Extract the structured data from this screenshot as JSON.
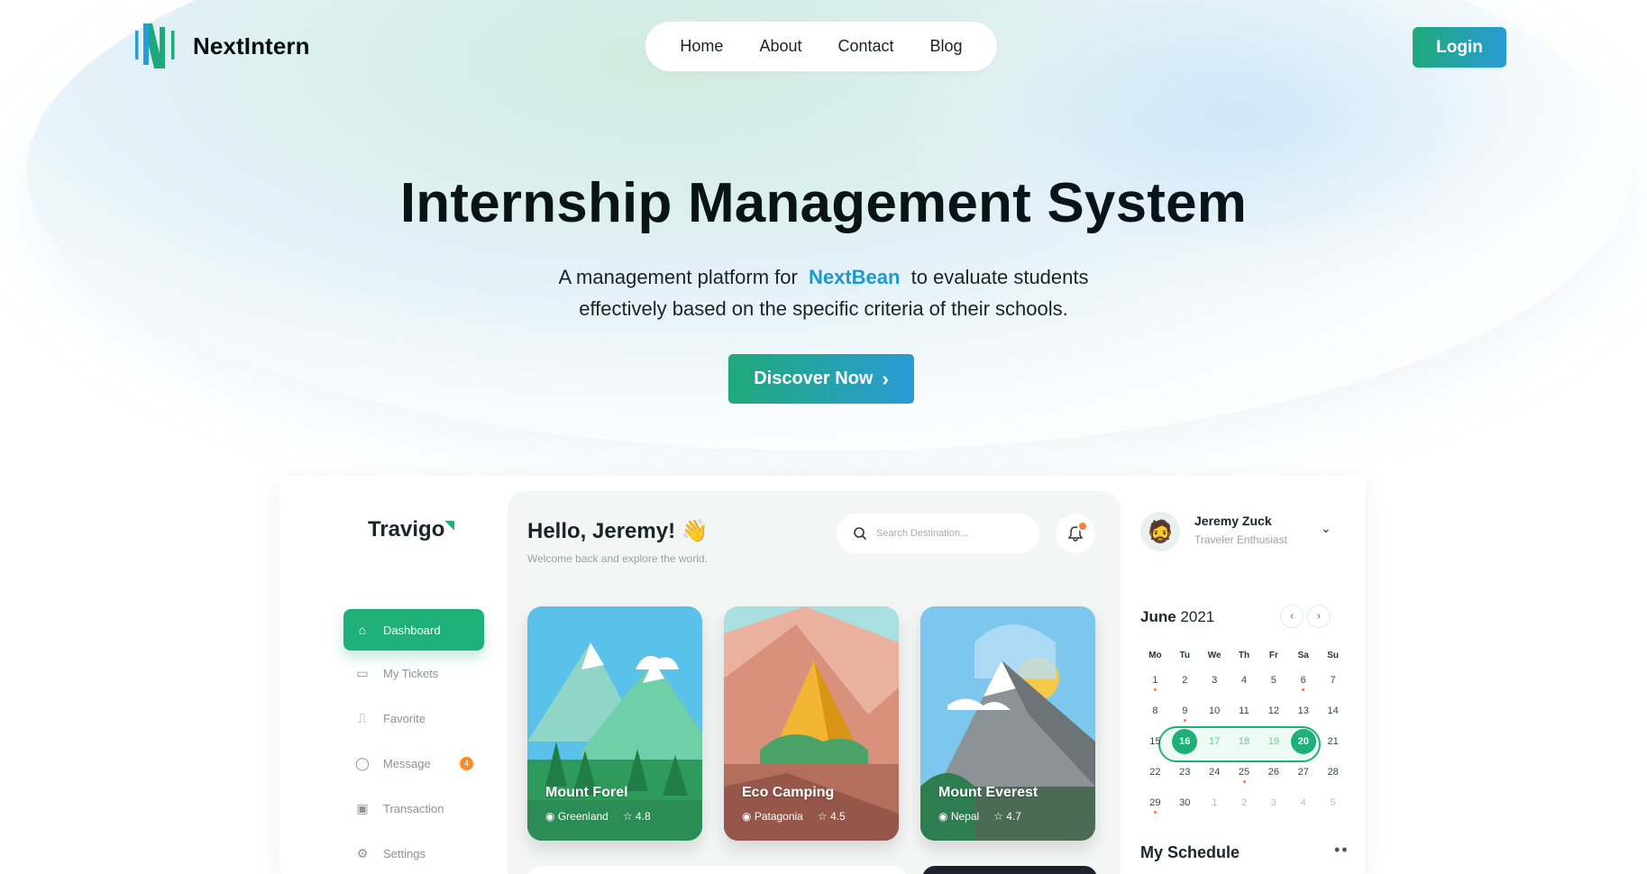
{
  "brand": {
    "name": "NextIntern"
  },
  "nav": {
    "items": [
      "Home",
      "About",
      "Contact",
      "Blog"
    ]
  },
  "login_label": "Login",
  "hero": {
    "title": "Internship Management System",
    "sub_before": "A management platform for",
    "sub_brand": "NextBean",
    "sub_after": "to evaluate students",
    "sub_line2": "effectively based on the specific criteria of their schools.",
    "cta": "Discover Now"
  },
  "colors": {
    "green": "#1fa97a",
    "blue": "#2a9bd6",
    "brand_text": "#1f9ac8"
  },
  "mock": {
    "brand": "Travigo",
    "sidebar": [
      "Dashboard",
      "My Tickets",
      "Favorite",
      "Message",
      "Transaction",
      "Settings"
    ],
    "message_badge": "4",
    "hello": "Hello, Jeremy! 👋",
    "welcome": "Welcome back and explore the world.",
    "search_placeholder": "Search Destination...",
    "cards": [
      {
        "name": "Mount Forel",
        "location": "Greenland",
        "rating": "4.8"
      },
      {
        "name": "Eco Camping",
        "location": "Patagonia",
        "rating": "4.5"
      },
      {
        "name": "Mount Everest",
        "location": "Nepal",
        "rating": "4.7"
      }
    ],
    "user": {
      "name": "Jeremy Zuck",
      "role": "Traveler Enthusiast"
    },
    "calendar": {
      "month": "June",
      "year": "2021",
      "weekdays": [
        "Mo",
        "Tu",
        "We",
        "Th",
        "Fr",
        "Sa",
        "Su"
      ],
      "weeks": [
        [
          "1",
          "2",
          "3",
          "4",
          "5",
          "6",
          "7"
        ],
        [
          "8",
          "9",
          "10",
          "11",
          "12",
          "13",
          "14"
        ],
        [
          "15",
          "16",
          "17",
          "18",
          "19",
          "20",
          "21"
        ],
        [
          "22",
          "23",
          "24",
          "25",
          "26",
          "27",
          "28"
        ],
        [
          "29",
          "30",
          "1",
          "2",
          "3",
          "4",
          "5"
        ]
      ],
      "range_start": "16",
      "range_end": "20"
    },
    "schedule_title": "My Schedule"
  }
}
